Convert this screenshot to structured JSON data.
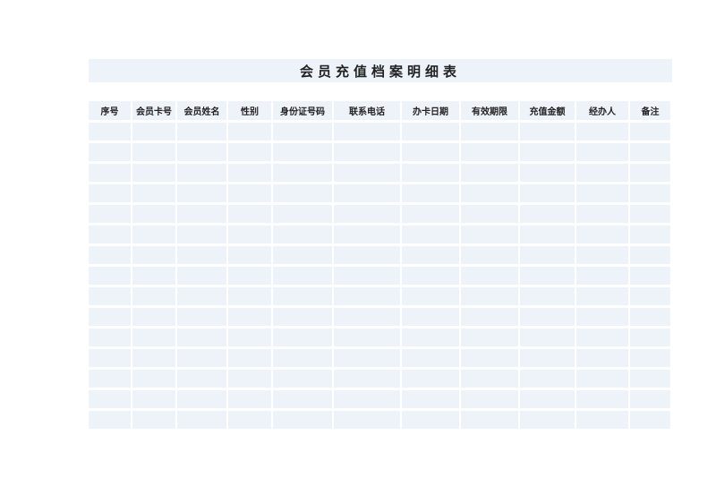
{
  "document": {
    "title": "会员充值档案明细表"
  },
  "table": {
    "columns": [
      "序号",
      "会员卡号",
      "会员姓名",
      "性别",
      "身份证号码",
      "联系电话",
      "办卡日期",
      "有效期限",
      "充值金额",
      "经办人",
      "备注"
    ],
    "empty_row_count": 15
  }
}
